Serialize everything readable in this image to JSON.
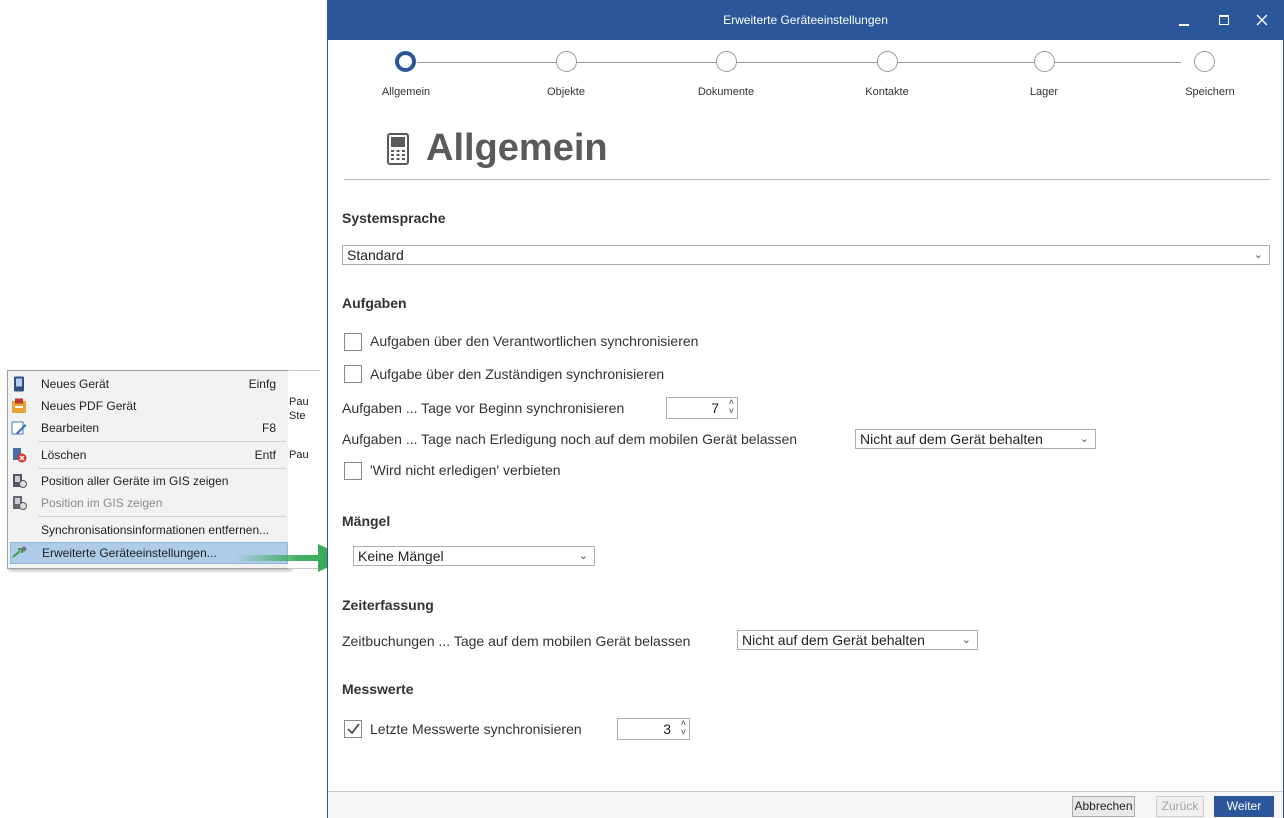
{
  "context_menu": {
    "items": [
      {
        "label": "Neues Gerät",
        "shortcut": "Einfg",
        "icon": "phone-icon"
      },
      {
        "label": "Neues PDF Gerät",
        "shortcut": "",
        "icon": "pdf-device-icon"
      },
      {
        "label": "Bearbeiten",
        "shortcut": "F8",
        "icon": "edit-icon"
      },
      {
        "label": "Löschen",
        "shortcut": "Entf",
        "icon": "delete-icon"
      },
      {
        "label": "Position aller Geräte im GIS zeigen",
        "shortcut": "",
        "icon": "gis-icon"
      },
      {
        "label": "Position im GIS zeigen",
        "shortcut": "",
        "icon": "gis-single-icon"
      },
      {
        "label": "Synchronisationsinformationen entfernen...",
        "shortcut": "",
        "icon": ""
      },
      {
        "label": "Erweiterte Geräteeinstellungen...",
        "shortcut": "",
        "icon": "settings-arrow-icon"
      }
    ],
    "peek": [
      "Pau",
      "Ste",
      "Pau"
    ]
  },
  "dialog": {
    "title": "Erweiterte Geräteeinstellungen",
    "steps": [
      "Allgemein",
      "Objekte",
      "Dokumente",
      "Kontakte",
      "Lager",
      "Speichern"
    ],
    "page_title": "Allgemein",
    "systemsprache": {
      "heading": "Systemsprache",
      "value": "Standard"
    },
    "aufgaben": {
      "heading": "Aufgaben",
      "cb1": "Aufgaben über den Verantwortlichen synchronisieren",
      "cb2": "Aufgabe über den Zuständigen synchronisieren",
      "days_before_label": "Aufgaben ... Tage vor Beginn synchronisieren",
      "days_before_value": "7",
      "days_after_label": "Aufgaben ... Tage nach Erledigung noch auf dem mobilen Gerät belassen",
      "days_after_value": "Nicht auf dem Gerät behalten",
      "cb3": "'Wird nicht erledigen' verbieten"
    },
    "maengel": {
      "heading": "Mängel",
      "value": "Keine Mängel"
    },
    "zeiterfassung": {
      "heading": "Zeiterfassung",
      "label": "Zeitbuchungen ... Tage auf dem mobilen Gerät belassen",
      "value": "Nicht auf dem Gerät behalten"
    },
    "messwerte": {
      "heading": "Messwerte",
      "cb_label": "Letzte Messwerte synchronisieren",
      "cb_checked": true,
      "value": "3"
    },
    "buttons": {
      "cancel": "Abbrechen",
      "back": "Zurück",
      "next": "Weiter"
    }
  },
  "colors": {
    "accent": "#2b579a",
    "arrow": "#2fa84f"
  }
}
